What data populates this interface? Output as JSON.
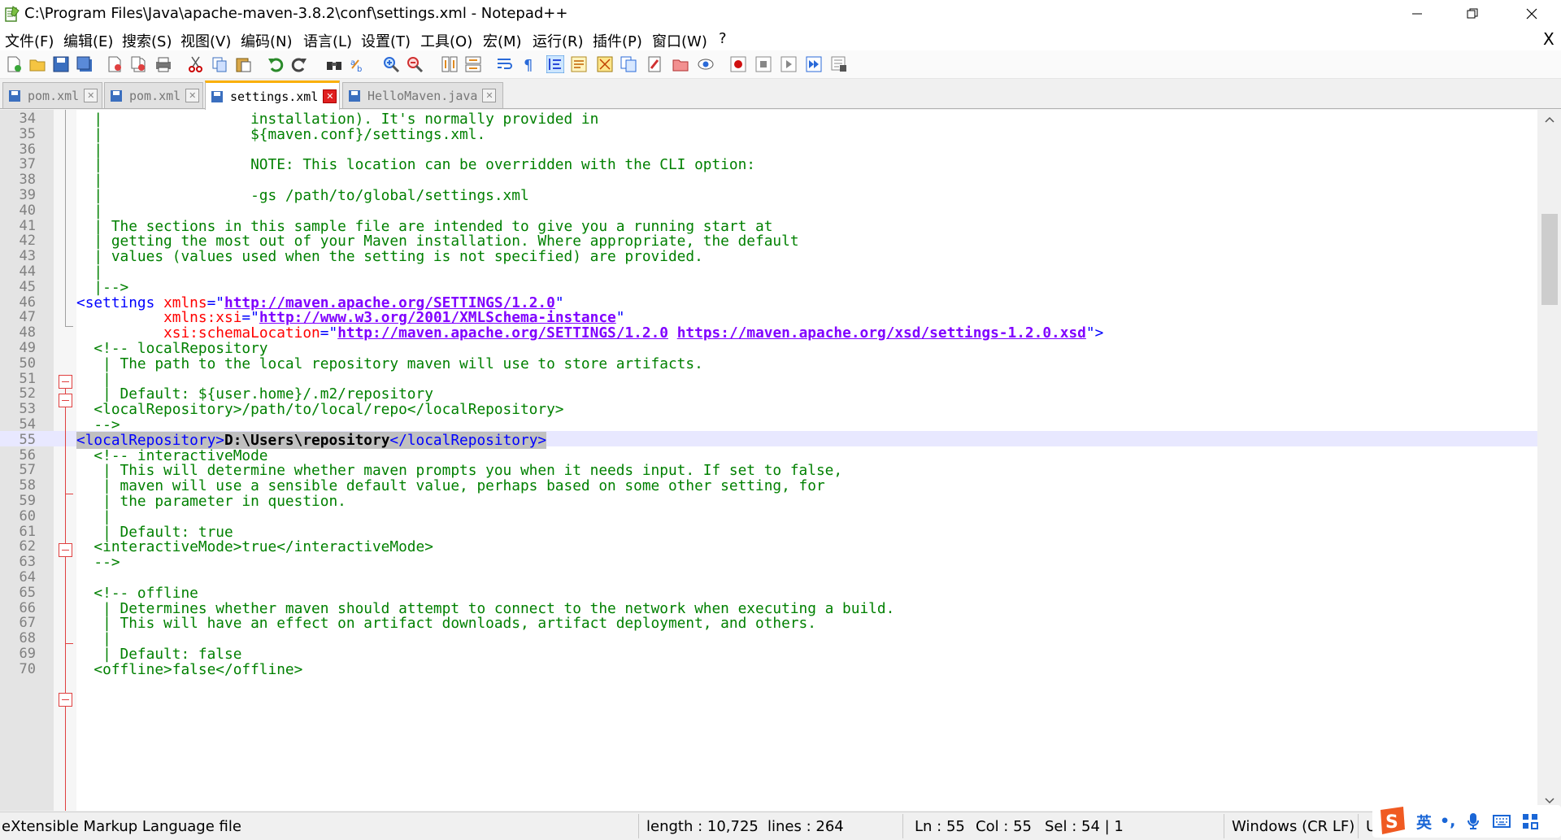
{
  "window": {
    "title": "C:\\Program Files\\Java\\apache-maven-3.8.2\\conf\\settings.xml - Notepad++",
    "minimize": "—",
    "maximize": "❐",
    "close": "✕"
  },
  "menu": {
    "items": [
      "文件(F)",
      "编辑(E)",
      "搜索(S)",
      "视图(V)",
      "编码(N)",
      "语言(L)",
      "设置(T)",
      "工具(O)",
      "宏(M)",
      "运行(R)",
      "插件(P)",
      "窗口(W)",
      "?"
    ],
    "close_doc": "X"
  },
  "tabs": [
    {
      "label": "pom.xml",
      "active": false,
      "close": "✕"
    },
    {
      "label": "pom.xml",
      "active": false,
      "close": "✕"
    },
    {
      "label": "settings.xml",
      "active": true,
      "close": "✕"
    },
    {
      "label": "HelloMaven.java",
      "active": false,
      "close": "✕"
    }
  ],
  "editor": {
    "current_line": 55,
    "lines": [
      {
        "n": "34",
        "t": "  |                 installation). It's normally provided in"
      },
      {
        "n": "35",
        "t": "  |                 ${maven.conf}/settings.xml."
      },
      {
        "n": "36",
        "t": "  |"
      },
      {
        "n": "37",
        "t": "  |                 NOTE: This location can be overridden with the CLI option:"
      },
      {
        "n": "38",
        "t": "  |"
      },
      {
        "n": "39",
        "t": "  |                 -gs /path/to/global/settings.xml"
      },
      {
        "n": "40",
        "t": "  |"
      },
      {
        "n": "41",
        "t": "  | The sections in this sample file are intended to give you a running start at"
      },
      {
        "n": "42",
        "t": "  | getting the most out of your Maven installation. Where appropriate, the default"
      },
      {
        "n": "43",
        "t": "  | values (values used when the setting is not specified) are provided."
      },
      {
        "n": "44",
        "t": "  |"
      },
      {
        "n": "45",
        "t": "  |-->"
      },
      {
        "n": "46",
        "t": ""
      },
      {
        "n": "47",
        "t": ""
      },
      {
        "n": "48",
        "t": ""
      },
      {
        "n": "49",
        "t": "  <!-- localRepository"
      },
      {
        "n": "50",
        "t": "   | The path to the local repository maven will use to store artifacts."
      },
      {
        "n": "51",
        "t": "   |"
      },
      {
        "n": "52",
        "t": "   | Default: ${user.home}/.m2/repository"
      },
      {
        "n": "53",
        "t": "  <localRepository>/path/to/local/repo</localRepository>"
      },
      {
        "n": "54",
        "t": "  -->"
      },
      {
        "n": "55",
        "t": ""
      },
      {
        "n": "56",
        "t": "  <!-- interactiveMode"
      },
      {
        "n": "57",
        "t": "   | This will determine whether maven prompts you when it needs input. If set to false,"
      },
      {
        "n": "58",
        "t": "   | maven will use a sensible default value, perhaps based on some other setting, for"
      },
      {
        "n": "59",
        "t": "   | the parameter in question."
      },
      {
        "n": "60",
        "t": "   |"
      },
      {
        "n": "61",
        "t": "   | Default: true"
      },
      {
        "n": "62",
        "t": "  <interactiveMode>true</interactiveMode>"
      },
      {
        "n": "63",
        "t": "  -->"
      },
      {
        "n": "64",
        "t": ""
      },
      {
        "n": "65",
        "t": "  <!-- offline"
      },
      {
        "n": "66",
        "t": "   | Determines whether maven should attempt to connect to the network when executing a build."
      },
      {
        "n": "67",
        "t": "   | This will have an effect on artifact downloads, artifact deployment, and others."
      },
      {
        "n": "68",
        "t": "   |"
      },
      {
        "n": "69",
        "t": "   | Default: false"
      },
      {
        "n": "70",
        "t": "  <offline>false</offline>"
      }
    ],
    "l46": {
      "open": "<settings",
      "attr": " xmlns",
      "eq": "=\"",
      "val": "http://maven.apache.org/SETTINGS/1.2.0",
      "end": "\""
    },
    "l47": {
      "indent": "          ",
      "attr": "xmlns:xsi",
      "eq": "=\"",
      "val": "http://www.w3.org/2001/XMLSchema-instance",
      "end": "\""
    },
    "l48": {
      "indent": "          ",
      "attr": "xsi:schemaLocation",
      "eq": "=\"",
      "val1": "http://maven.apache.org/SETTINGS/1.2.0",
      "sp": " ",
      "val2": "https://maven.apache.org/xsd/settings-1.2.0.xsd",
      "end": "\">"
    },
    "l55": {
      "open": "<localRepository>",
      "text": "D:\\Users\\repository",
      "close": "</localRepository>"
    }
  },
  "status": {
    "file_type": "eXtensible Markup Language file",
    "length": "length : 10,725",
    "lines": "lines : 264",
    "ln": "Ln : 55",
    "col": "Col : 55",
    "sel": "Sel : 54 | 1",
    "eol": "Windows (CR LF)",
    "enc": "U"
  },
  "ime": {
    "lang": "英",
    "punct": "•,"
  },
  "colors": {
    "comment": "#008000",
    "tag": "#0000ff",
    "attr": "#ff0000",
    "value": "#8000ff",
    "current_line": "#e8e8ff",
    "active_tab_accent": "#fab00a"
  }
}
